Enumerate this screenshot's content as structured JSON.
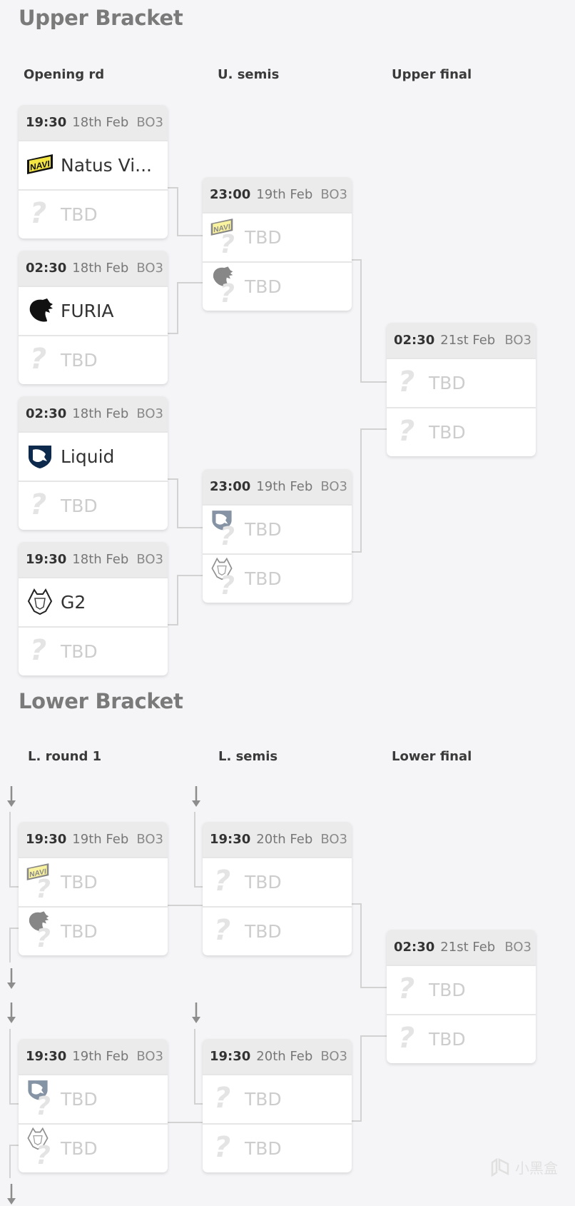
{
  "upper": {
    "title": "Upper Bracket",
    "columns": [
      "Opening rd",
      "U. semis",
      "Upper final"
    ],
    "matches": [
      {
        "time": "19:30",
        "date": "18th Feb",
        "format": "BO3",
        "teams": [
          {
            "name": "Natus Vi...",
            "logo": "navi-logo",
            "tbd": false
          },
          {
            "name": "TBD",
            "logo": "question-icon",
            "tbd": true
          }
        ]
      },
      {
        "time": "02:30",
        "date": "18th Feb",
        "format": "BO3",
        "teams": [
          {
            "name": "FURIA",
            "logo": "furia-logo",
            "tbd": false
          },
          {
            "name": "TBD",
            "logo": "question-icon",
            "tbd": true
          }
        ]
      },
      {
        "time": "02:30",
        "date": "18th Feb",
        "format": "BO3",
        "teams": [
          {
            "name": "Liquid",
            "logo": "liquid-logo",
            "tbd": false
          },
          {
            "name": "TBD",
            "logo": "question-icon",
            "tbd": true
          }
        ]
      },
      {
        "time": "19:30",
        "date": "18th Feb",
        "format": "BO3",
        "teams": [
          {
            "name": "G2",
            "logo": "g2-logo",
            "tbd": false
          },
          {
            "name": "TBD",
            "logo": "question-icon",
            "tbd": true
          }
        ]
      },
      {
        "time": "23:00",
        "date": "19th Feb",
        "format": "BO3",
        "teams": [
          {
            "name": "TBD",
            "logo": "navi-ghost",
            "tbd": true
          },
          {
            "name": "TBD",
            "logo": "furia-ghost",
            "tbd": true
          }
        ]
      },
      {
        "time": "23:00",
        "date": "19th Feb",
        "format": "BO3",
        "teams": [
          {
            "name": "TBD",
            "logo": "liquid-ghost",
            "tbd": true
          },
          {
            "name": "TBD",
            "logo": "g2-ghost",
            "tbd": true
          }
        ]
      },
      {
        "time": "02:30",
        "date": "21st Feb",
        "format": "BO3",
        "teams": [
          {
            "name": "TBD",
            "logo": "question-icon",
            "tbd": true
          },
          {
            "name": "TBD",
            "logo": "question-icon",
            "tbd": true
          }
        ]
      }
    ]
  },
  "lower": {
    "title": "Lower Bracket",
    "columns": [
      "L. round 1",
      "L. semis",
      "Lower final"
    ],
    "matches": [
      {
        "time": "19:30",
        "date": "19th Feb",
        "format": "BO3",
        "teams": [
          {
            "name": "TBD",
            "logo": "navi-ghost",
            "tbd": true
          },
          {
            "name": "TBD",
            "logo": "furia-ghost",
            "tbd": true
          }
        ]
      },
      {
        "time": "19:30",
        "date": "19th Feb",
        "format": "BO3",
        "teams": [
          {
            "name": "TBD",
            "logo": "liquid-ghost",
            "tbd": true
          },
          {
            "name": "TBD",
            "logo": "g2-ghost",
            "tbd": true
          }
        ]
      },
      {
        "time": "19:30",
        "date": "20th Feb",
        "format": "BO3",
        "teams": [
          {
            "name": "TBD",
            "logo": "question-icon",
            "tbd": true
          },
          {
            "name": "TBD",
            "logo": "question-icon",
            "tbd": true
          }
        ]
      },
      {
        "time": "19:30",
        "date": "20th Feb",
        "format": "BO3",
        "teams": [
          {
            "name": "TBD",
            "logo": "question-icon",
            "tbd": true
          },
          {
            "name": "TBD",
            "logo": "question-icon",
            "tbd": true
          }
        ]
      },
      {
        "time": "02:30",
        "date": "21st Feb",
        "format": "BO3",
        "teams": [
          {
            "name": "TBD",
            "logo": "question-icon",
            "tbd": true
          },
          {
            "name": "TBD",
            "logo": "question-icon",
            "tbd": true
          }
        ]
      }
    ]
  },
  "watermark": "小黑盒",
  "colors": {
    "navi": "#f4e642",
    "liquid": "#0d2a4d",
    "furia": "#111111",
    "tbd": "#cdcdcd"
  }
}
